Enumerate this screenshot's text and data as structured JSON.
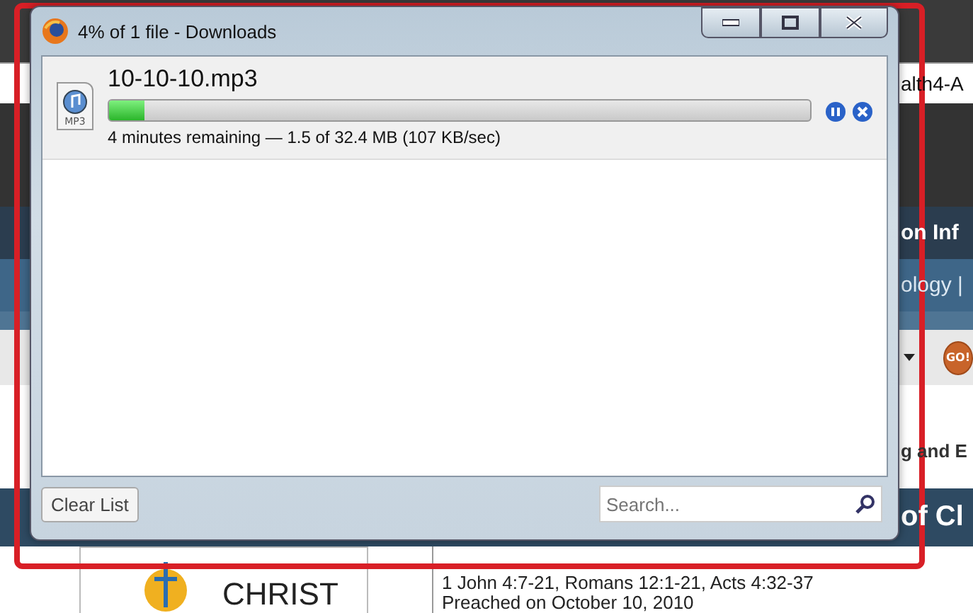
{
  "window": {
    "title": "4% of 1 file - Downloads"
  },
  "downloads": [
    {
      "filename": "10-10-10.mp3",
      "level": 0.05,
      "file_type": "MP3",
      "status": "4 minutes remaining — 1.5 of 32.4 MB (107 KB/sec)"
    }
  ],
  "footer": {
    "clear_button": "Clear List",
    "search": {
      "placeholder": "Search..."
    }
  },
  "background_page": {
    "snippets": [
      "alth4-A",
      "on Inf",
      "ology |"
    ],
    "go_button": "GO!",
    "heading_fragment": "g and E",
    "banner_fragment": "of Cl",
    "logo_text": "CHRIST",
    "passage": "1 John 4:7-21, Romans 12:1-21, Acts 4:32-37",
    "preached": "Preached on October 10, 2010"
  }
}
